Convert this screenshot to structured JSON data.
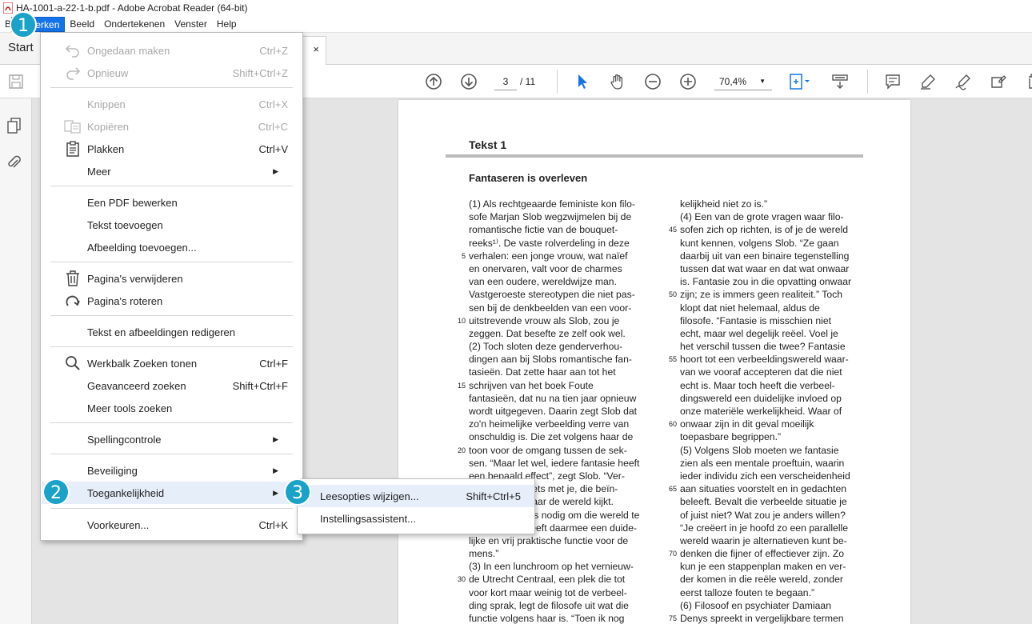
{
  "window": {
    "title": "HA-1001-a-22-1-b.pdf - Adobe Acrobat Reader (64-bit)"
  },
  "menubar": {
    "items": [
      "B",
      "Bewerken",
      "Beeld",
      "Ondertekenen",
      "Venster",
      "Help"
    ]
  },
  "tabs": {
    "start": "Start",
    "close": "×"
  },
  "toolbar": {
    "page_current": "3",
    "page_total": "/ 11",
    "zoom": "70,4%"
  },
  "menu": {
    "items": [
      {
        "label": "Ongedaan maken",
        "shortcut": "Ctrl+Z",
        "icon": "undo-icon",
        "disabled": true
      },
      {
        "label": "Opnieuw",
        "shortcut": "Shift+Ctrl+Z",
        "icon": "redo-icon",
        "disabled": true
      },
      {
        "label": "Knippen",
        "shortcut": "Ctrl+X",
        "disabled": true
      },
      {
        "label": "Kopiëren",
        "shortcut": "Ctrl+C",
        "icon": "copy-icon",
        "disabled": true
      },
      {
        "label": "Plakken",
        "shortcut": "Ctrl+V",
        "icon": "paste-icon"
      },
      {
        "label": "Meer",
        "submenu": true
      },
      {
        "label": "Een PDF bewerken"
      },
      {
        "label": "Tekst toevoegen"
      },
      {
        "label": "Afbeelding toevoegen..."
      },
      {
        "label": "Pagina's verwijderen",
        "icon": "trash-icon"
      },
      {
        "label": "Pagina's roteren",
        "icon": "rotate-icon"
      },
      {
        "label": "Tekst en afbeeldingen redigeren"
      },
      {
        "label": "Werkbalk Zoeken tonen",
        "shortcut": "Ctrl+F",
        "icon": "search-icon"
      },
      {
        "label": "Geavanceerd zoeken",
        "shortcut": "Shift+Ctrl+F"
      },
      {
        "label": "Meer tools zoeken"
      },
      {
        "label": "Spellingcontrole",
        "submenu": true
      },
      {
        "label": "Beveiliging",
        "submenu": true
      },
      {
        "label": "Toegankelijkheid",
        "submenu": true
      },
      {
        "label": "Voorkeuren...",
        "shortcut": "Ctrl+K"
      }
    ]
  },
  "submenu": {
    "items": [
      {
        "label": "Leesopties wijzigen...",
        "shortcut": "Shift+Ctrl+5"
      },
      {
        "label": "Instellingsassistent..."
      }
    ]
  },
  "badges": [
    "1",
    "2",
    "3"
  ],
  "document": {
    "heading": "Tekst 1",
    "subheading": "Fantaseren is overleven",
    "col1": [
      {
        "n": "",
        "t": "(1) Als rechtgeaarde feministe kon filo-"
      },
      {
        "n": "",
        "t": "sofe Marjan Slob wegzwijmelen bij de"
      },
      {
        "n": "",
        "t": "romantische fictie van de bouquet-"
      },
      {
        "n": "",
        "t": "reeks¹⁾. De vaste rolverdeling in deze"
      },
      {
        "n": "5",
        "t": "verhalen: een jonge vrouw, wat naïef"
      },
      {
        "n": "",
        "t": "en onervaren, valt voor de charmes"
      },
      {
        "n": "",
        "t": "van een oudere, wereldwijze man."
      },
      {
        "n": "",
        "t": "Vastgeroeste stereotypen die niet pas-"
      },
      {
        "n": "",
        "t": "sen bij de denkbeelden van een voor-"
      },
      {
        "n": "10",
        "t": "uitstrevende vrouw als Slob, zou je"
      },
      {
        "n": "",
        "t": "zeggen. Dat besefte ze zelf ook wel."
      },
      {
        "n": "",
        "t": "(2) Toch sloten deze genderverhou-"
      },
      {
        "n": "",
        "t": "dingen aan bij Slobs romantische fan-"
      },
      {
        "n": "",
        "t": "tasieën. Dat zette haar aan tot het"
      },
      {
        "n": "15",
        "t": "schrijven van het boek Foute"
      },
      {
        "n": "",
        "t": "fantasieën, dat nu na tien jaar opnieuw"
      },
      {
        "n": "",
        "t": "wordt uitgegeven. Daarin zegt Slob dat"
      },
      {
        "n": "",
        "t": "zo'n heimelijke verbeelding verre van"
      },
      {
        "n": "",
        "t": "onschuldig is. Die zet volgens haar de"
      },
      {
        "n": "20",
        "t": "toon voor de omgang tussen de sek-"
      },
      {
        "n": "",
        "t": "sen. “Maar let wel, iedere fantasie heeft"
      },
      {
        "n": "",
        "t": "een bepaald effect”, zegt Slob. “Ver-"
      },
      {
        "n": "",
        "t": "beelding doet iets met je, die beïn-"
      },
      {
        "n": "",
        "t": "vloedt hoe je naar de wereld kijkt."
      },
      {
        "n": "25",
        "t": "Fantasie is zelfs nodig om die wereld te"
      },
      {
        "n": "",
        "t": "begrijpen en heeft daarmee een duide-"
      },
      {
        "n": "",
        "t": "lijke en vrij praktische functie voor de"
      },
      {
        "n": "",
        "t": "mens.”"
      },
      {
        "n": "",
        "t": "(3) In een lunchroom op het vernieuw-"
      },
      {
        "n": "30",
        "t": "de Utrecht Centraal, een plek die tot"
      },
      {
        "n": "",
        "t": "voor kort maar weinig tot de verbeel-"
      },
      {
        "n": "",
        "t": "ding sprak, legt de filosofe uit wat die"
      },
      {
        "n": "",
        "t": "functie volgens haar is. “Toen ik nog"
      }
    ],
    "col2": [
      {
        "n": "",
        "t": "kelijkheid niet zo is.”"
      },
      {
        "n": "",
        "t": "(4) Een van de grote vragen waar filo-"
      },
      {
        "n": "45",
        "t": "sofen zich op richten, is of je de wereld"
      },
      {
        "n": "",
        "t": "kunt kennen, volgens Slob. “Ze gaan"
      },
      {
        "n": "",
        "t": "daarbij uit van een binaire tegenstelling"
      },
      {
        "n": "",
        "t": "tussen dat wat waar en dat wat onwaar"
      },
      {
        "n": "",
        "t": "is. Fantasie zou in die opvatting onwaar"
      },
      {
        "n": "50",
        "t": "zijn; ze is immers geen realiteit.” Toch"
      },
      {
        "n": "",
        "t": "klopt dat niet helemaal, aldus de"
      },
      {
        "n": "",
        "t": "filosofe. “Fantasie is misschien niet"
      },
      {
        "n": "",
        "t": "echt, maar wel degelijk reëel. Voel je"
      },
      {
        "n": "",
        "t": "het verschil tussen die twee? Fantasie"
      },
      {
        "n": "55",
        "t": "hoort tot een verbeeldingswereld waar-"
      },
      {
        "n": "",
        "t": "van we vooraf accepteren dat die niet"
      },
      {
        "n": "",
        "t": "echt is. Maar toch heeft die verbeel-"
      },
      {
        "n": "",
        "t": "dingswereld een duidelijke invloed op"
      },
      {
        "n": "",
        "t": "onze materiële werkelijkheid. Waar of"
      },
      {
        "n": "60",
        "t": "onwaar zijn in dit geval moeilijk"
      },
      {
        "n": "",
        "t": "toepasbare begrippen.”"
      },
      {
        "n": "",
        "t": "(5) Volgens Slob moeten we fantasie"
      },
      {
        "n": "",
        "t": "zien als een mentale proeftuin, waarin"
      },
      {
        "n": "",
        "t": "ieder individu zich een verscheidenheid"
      },
      {
        "n": "65",
        "t": "aan situaties voorstelt en in gedachten"
      },
      {
        "n": "",
        "t": "beleeft. Bevalt die verbeelde situatie je"
      },
      {
        "n": "",
        "t": "of juist niet? Wat zou je anders willen?"
      },
      {
        "n": "",
        "t": "“Je creëert in je hoofd zo een parallelle"
      },
      {
        "n": "",
        "t": "wereld waarin je alternatieven kunt be-"
      },
      {
        "n": "70",
        "t": "denken die fijner of effectiever zijn. Zo"
      },
      {
        "n": "",
        "t": "kun je een stappenplan maken en ver-"
      },
      {
        "n": "",
        "t": "der komen in die reële wereld, zonder"
      },
      {
        "n": "",
        "t": "eerst talloze fouten te begaan.”"
      },
      {
        "n": "",
        "t": "(6) Filosoof en psychiater Damiaan"
      },
      {
        "n": "75",
        "t": "Denys spreekt in vergelijkbare termen"
      }
    ]
  }
}
